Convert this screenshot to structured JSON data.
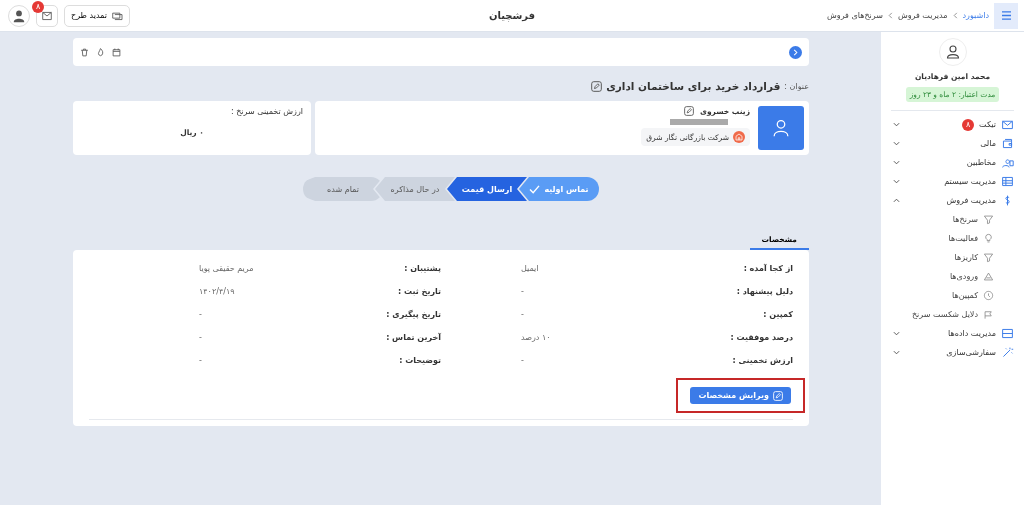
{
  "topbar": {
    "app_title": "فرشچیان",
    "breadcrumb": [
      "داشبورد",
      "مدیریت فروش",
      "سرنخ‌های فروش"
    ],
    "renew_button": "تمدید طرح",
    "mail_badge": "۸"
  },
  "sidebar": {
    "user_name": "محمد امین فرهادیان",
    "validity": "مدت اعتبار: ۲ ماه و ۲۳ روز",
    "items": [
      {
        "label": "تیکت",
        "badge": "۸",
        "expanded": false
      },
      {
        "label": "مالی",
        "expanded": false
      },
      {
        "label": "مخاطبین",
        "expanded": false
      },
      {
        "label": "مدیریت سیستم",
        "expanded": false
      },
      {
        "label": "مدیریت فروش",
        "expanded": true,
        "children": [
          {
            "label": "سرنخ‌ها"
          },
          {
            "label": "فعالیت‌ها"
          },
          {
            "label": "کاریزها"
          },
          {
            "label": "ورودی‌ها"
          },
          {
            "label": "کمپین‌ها"
          },
          {
            "label": "دلایل شکست سرنخ"
          }
        ]
      },
      {
        "label": "مدیریت داده‌ها",
        "expanded": false
      },
      {
        "label": "سفارشی‌سازی",
        "expanded": false
      }
    ]
  },
  "lead": {
    "title_label": "عنوان :",
    "title": "قرارداد خرید برای ساختمان اداری",
    "contact_name": "زینب خسروی",
    "company": "شرکت بازرگانی نگار شرق",
    "value_label": "ارزش تخمینی سرنخ :",
    "value": "۰ ریال"
  },
  "stages": [
    {
      "label": "تماس اولیه",
      "completed": true,
      "selected": false
    },
    {
      "label": "ارسال قیمت",
      "completed": false,
      "selected": true
    },
    {
      "label": "در حال مذاکره",
      "completed": false,
      "selected": false
    },
    {
      "label": "تمام شده",
      "completed": false,
      "selected": false
    }
  ],
  "tabs": [
    {
      "label": "مشخصات",
      "selected": true
    }
  ],
  "details": [
    {
      "label": "از کجا آمده :",
      "value": "ایمیل"
    },
    {
      "label": "پشتیبان :",
      "value": "مریم حقیقی پویا"
    },
    {
      "label": "دلیل پیشنهاد :",
      "value": "-"
    },
    {
      "label": "تاریخ ثبت :",
      "value": "۱۴۰۲/۴/۱۹"
    },
    {
      "label": "کمپین :",
      "value": "-"
    },
    {
      "label": "تاریخ پیگیری :",
      "value": "-"
    },
    {
      "label": "درصد موفقیت :",
      "value": "۱۰ درصد"
    },
    {
      "label": "آخرین تماس :",
      "value": "-"
    },
    {
      "label": "ارزش تخمینی :",
      "value": "-"
    },
    {
      "label": "توضیحات :",
      "value": "-"
    }
  ],
  "edit_button": "ویرایش مشخصات"
}
